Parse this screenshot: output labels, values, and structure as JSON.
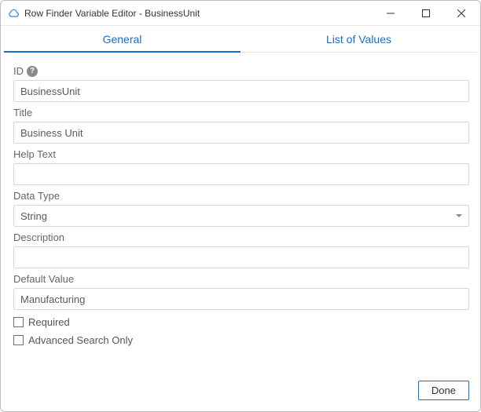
{
  "window": {
    "title": "Row Finder Variable Editor - BusinessUnit"
  },
  "tabs": {
    "general": "General",
    "listOfValues": "List of Values"
  },
  "labels": {
    "id": "ID",
    "title": "Title",
    "helpText": "Help Text",
    "dataType": "Data Type",
    "description": "Description",
    "defaultValue": "Default Value",
    "required": "Required",
    "advancedSearchOnly": "Advanced Search Only"
  },
  "values": {
    "id": "BusinessUnit",
    "title": "Business Unit",
    "helpText": "",
    "dataType": "String",
    "description": "",
    "defaultValue": "Manufacturing",
    "required": false,
    "advancedSearchOnly": false
  },
  "buttons": {
    "done": "Done"
  },
  "colors": {
    "accent": "#1a6cc8",
    "border": "#d7d7d7"
  }
}
